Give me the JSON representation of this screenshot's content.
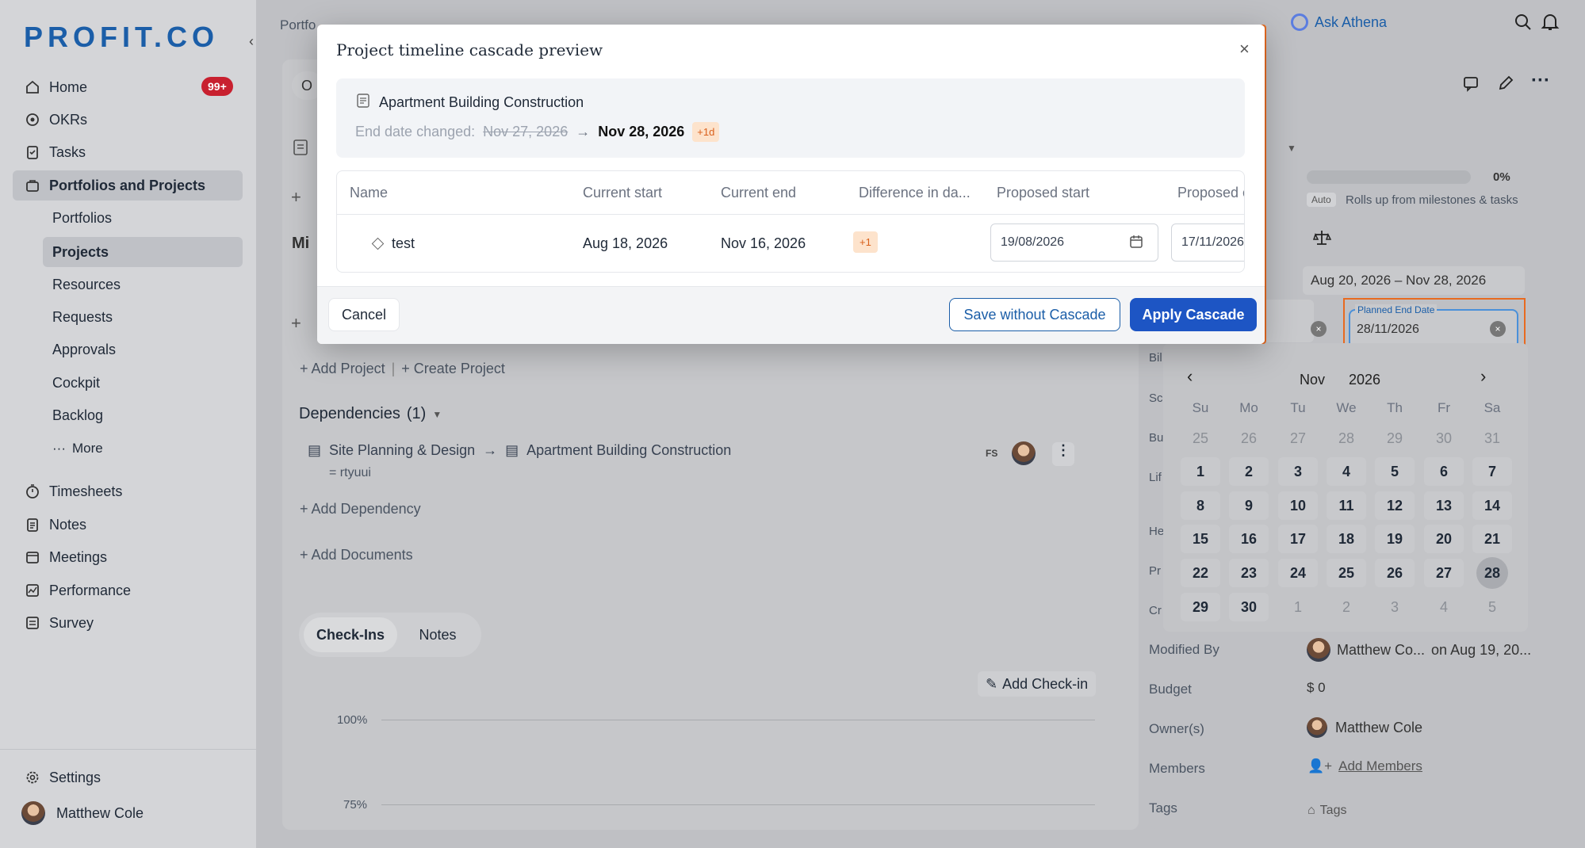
{
  "brand": {
    "logo": "PROFIT.CO"
  },
  "sidebar": {
    "home": "Home",
    "home_badge": "99+",
    "okrs": "OKRs",
    "tasks": "Tasks",
    "portfolios_projects": "Portfolios and Projects",
    "sub": [
      "Portfolios",
      "Projects",
      "Resources",
      "Requests",
      "Approvals",
      "Cockpit",
      "Backlog"
    ],
    "more": "More",
    "bottom": [
      "Timesheets",
      "Notes",
      "Meetings",
      "Performance",
      "Survey"
    ],
    "settings": "Settings",
    "user": "Matthew Cole"
  },
  "header": {
    "breadcrumb_start": "Portfo",
    "breadcrumb_tail": "",
    "ask": "Ask Athena"
  },
  "main": {
    "tab_stub": "O",
    "section_stub": "Mi",
    "add_project": "Add Project",
    "create_project": "Create Project",
    "dependencies_title": "Dependencies",
    "dependencies_count": "(1)",
    "dep_from": "Site Planning & Design",
    "dep_to": "Apartment Building Construction",
    "dep_sub": "rtyuui",
    "dep_type": "FS",
    "add_dependency": "Add Dependency",
    "add_documents": "Add Documents",
    "tabs": [
      "Check-Ins",
      "Notes"
    ],
    "add_checkin": "Add Check-in",
    "axis": [
      "100%",
      "75%"
    ]
  },
  "right": {
    "progress": "0%",
    "auto": "Auto",
    "rollup": "Rolls up from milestones & tasks",
    "date_range": "Aug 20, 2026 – Nov 28, 2026",
    "planned_end_label": "Planned End Date",
    "planned_end_value": "28/11/2026",
    "labels_short": [
      "Bil",
      "Sc",
      "Bu",
      "Lif",
      "He",
      "Pr",
      "Cr"
    ],
    "modified_by_label": "Modified By",
    "modified_by_value": "Matthew Co...",
    "modified_on": "on Aug 19, 20...",
    "budget_label": "Budget",
    "budget_value": "$ 0",
    "owners_label": "Owner(s)",
    "owner_value": "Matthew Cole",
    "members_label": "Members",
    "add_members": "Add Members",
    "tags_label": "Tags",
    "tags_value": "Tags"
  },
  "calendar": {
    "month": "Nov",
    "year": "2026",
    "weekdays": [
      "Su",
      "Mo",
      "Tu",
      "We",
      "Th",
      "Fr",
      "Sa"
    ],
    "selected": 28,
    "rows": [
      [
        "25",
        "26",
        "27",
        "28",
        "29",
        "30",
        "31"
      ],
      [
        "1",
        "2",
        "3",
        "4",
        "5",
        "6",
        "7"
      ],
      [
        "8",
        "9",
        "10",
        "11",
        "12",
        "13",
        "14"
      ],
      [
        "15",
        "16",
        "17",
        "18",
        "19",
        "20",
        "21"
      ],
      [
        "22",
        "23",
        "24",
        "25",
        "26",
        "27",
        "28"
      ],
      [
        "29",
        "30",
        "1",
        "2",
        "3",
        "4",
        "5"
      ]
    ]
  },
  "modal": {
    "title": "Project timeline cascade preview",
    "project": "Apartment Building Construction",
    "change_label": "End date changed:",
    "old_date": "Nov 27, 2026",
    "new_date": "Nov 28, 2026",
    "delta": "+1d",
    "columns": [
      "Name",
      "Current start",
      "Current end",
      "Difference in da...",
      "Proposed start",
      "Proposed e"
    ],
    "row": {
      "name": "test",
      "current_start": "Aug 18, 2026",
      "current_end": "Nov 16, 2026",
      "diff": "+1",
      "proposed_start": "19/08/2026",
      "proposed_end": "17/11/2026"
    },
    "cancel": "Cancel",
    "save_without": "Save without Cascade",
    "apply": "Apply Cascade"
  }
}
